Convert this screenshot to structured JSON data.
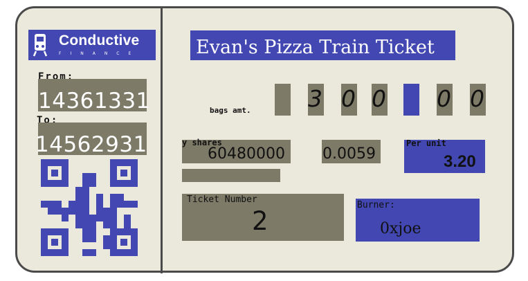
{
  "brand": {
    "name": "Conductive",
    "subtitle": "FINANCE",
    "icon": "train-icon",
    "color": "#4247b2"
  },
  "route": {
    "from_label": "From:",
    "from_value": "14361331",
    "to_label": "To:",
    "to_value": "14562931"
  },
  "ticket": {
    "title": "Evan's Pizza Train Ticket",
    "bags_label": "bags amt.",
    "bags_digits": [
      "3",
      "0",
      "0",
      "",
      "0",
      "0"
    ],
    "shares_label": "y shares",
    "shares_value": "60480000",
    "price_value": "0.0059",
    "per_unit_label": "Per unit",
    "per_unit_value": "3.20",
    "ticket_number_label": "Ticket Number",
    "ticket_number_value": "2",
    "burner_label": "Burner:",
    "burner_value": "0xjoe"
  },
  "colors": {
    "panel_gray": "#7d7a67",
    "ticket_bg": "#ebe9dc",
    "border": "#4a4a4a"
  },
  "icons": [
    "train-icon",
    "qr-code-icon"
  ]
}
